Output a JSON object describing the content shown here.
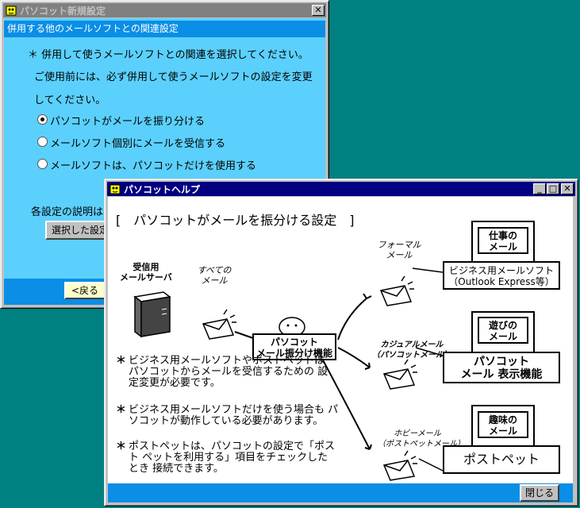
{
  "settings_window": {
    "title": "パソコット新規設定",
    "subheader": "併用する他のメールソフトとの関連設定",
    "instruction1": "＊ 併用して使うメールソフトとの関連を選択してください。",
    "instruction2": "ご使用前には、必ず併用して使うメールソフトの設定を変更",
    "instruction3": "してください。",
    "options": [
      {
        "label": "パソコットがメールを振り分ける",
        "selected": true
      },
      {
        "label": "メールソフト個別にメールを受信する",
        "selected": false
      },
      {
        "label": "メールソフトは、パソコットだけを使用する",
        "selected": false
      }
    ],
    "explain_text": "各設定の説明は、",
    "select_button": "選択した設定",
    "back_button": "<戻る"
  },
  "help_window": {
    "title": "パソコットヘルプ",
    "close_button": "閉じる",
    "heading": "[　パソコットがメールを振分ける設定　]",
    "diagram": {
      "server_label": [
        "受信用",
        "メールサーバ"
      ],
      "all_mail_label": [
        "すべての",
        "メール"
      ],
      "function_box": [
        "パソコット",
        "メール振分け機能"
      ],
      "formal_label": [
        "フォーマル",
        "メール"
      ],
      "casual_label": [
        "カジュアルメール",
        "（パソコットメール）"
      ],
      "hobby_label": [
        "ホビーメール",
        "（ポストペットメール）"
      ],
      "targets": [
        {
          "tag": [
            "仕事の",
            "メール"
          ],
          "app": [
            "ビジネス用メールソフト",
            "（Outlook Express等）"
          ]
        },
        {
          "tag": [
            "遊びの",
            "メール"
          ],
          "app": [
            "パソコット",
            "メール 表示機能"
          ]
        },
        {
          "tag": [
            "趣味の",
            "メール"
          ],
          "app": [
            "ポストペット"
          ]
        }
      ]
    },
    "notes": [
      "ビジネス用メールソフトやポストペットは パソコットからメールを受信するための 設定変更が必要です。",
      "ビジネス用メールソフトだけを使う場合も パソコットが動作している必要があります。",
      "ポストペットは、パソコットの設定で「ポスト ペットを利用する」項目をチェックしたとき 接続できます。"
    ],
    "note_marker": "＊"
  }
}
